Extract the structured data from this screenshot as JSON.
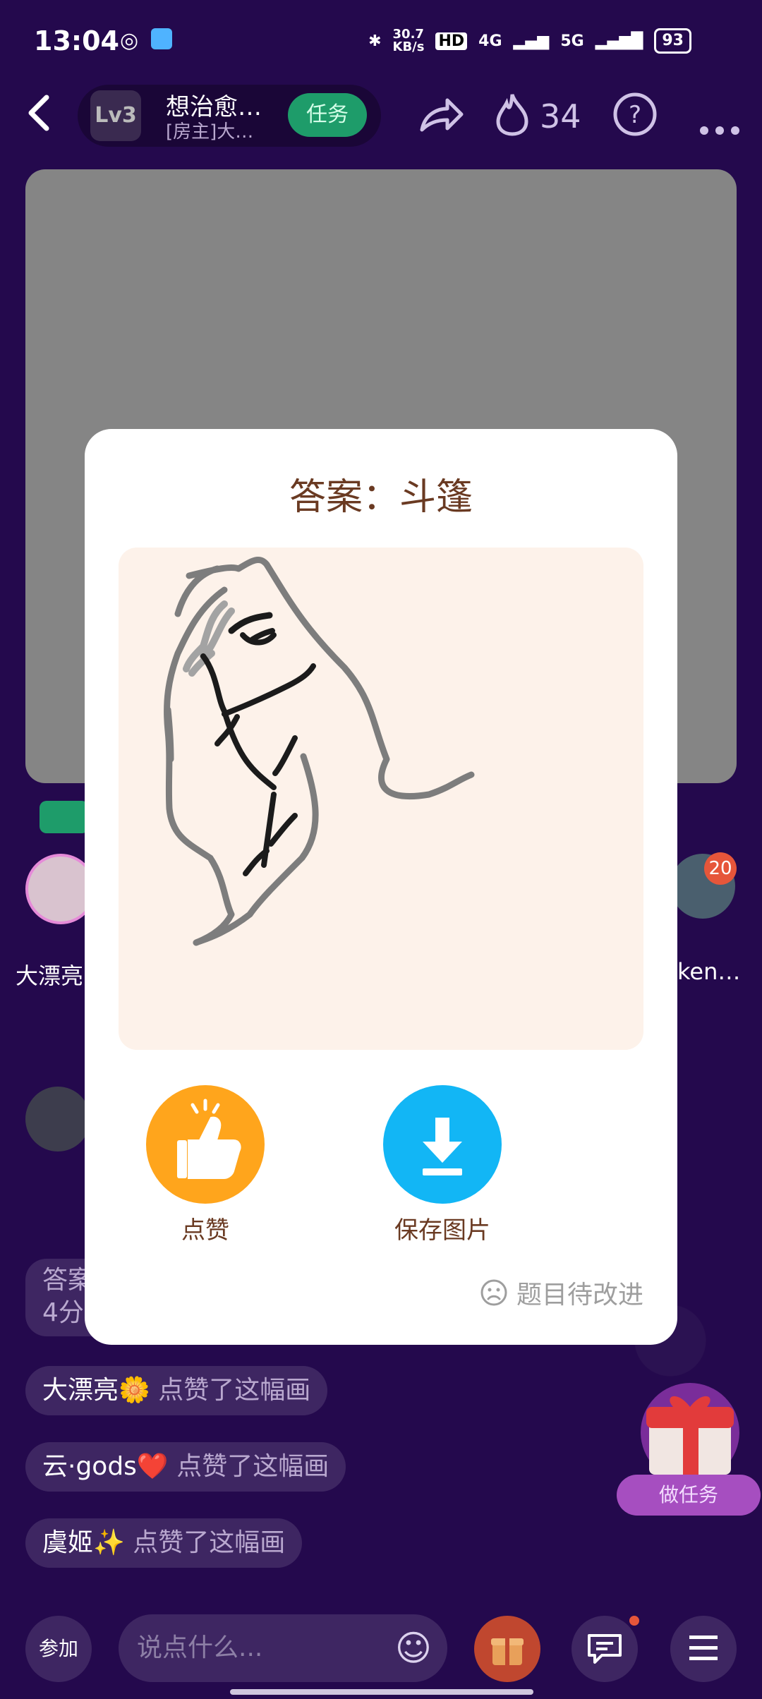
{
  "status": {
    "time": "13:04",
    "net_speed_value": "30.7",
    "net_speed_unit": "KB/s",
    "net1": "4G",
    "net2": "5G",
    "battery": "93"
  },
  "room": {
    "level": "Lv3",
    "name": "想治愈…",
    "owner": "[房主]大…",
    "task_label": "任务",
    "fire_count": "34"
  },
  "seats": {
    "left_name": "大漂亮",
    "right_name": "ken…",
    "right_badge": "20"
  },
  "modal": {
    "answer": "答案：斗篷",
    "like_label": "点赞",
    "save_label": "保存图片",
    "improve_label": "题目待改进"
  },
  "chat": [
    {
      "user": "大漂亮🌼",
      "action": "点赞了这幅画"
    },
    {
      "user": "云·gods❤️",
      "action": "点赞了这幅画"
    },
    {
      "user": "虞姬✨",
      "action": "点赞了这幅画"
    }
  ],
  "partial_msg": {
    "line1": "答案",
    "line2": "4分"
  },
  "bottom": {
    "join_label": "参加",
    "input_placeholder": "说点什么...",
    "gift_task_label": "做任务"
  },
  "colors": {
    "background": "#2d0c5e",
    "like": "#ffa51c",
    "save": "#12b6f5",
    "task": "#1e9c6a",
    "answer_text": "#6a3a22"
  },
  "icons": [
    "back-icon",
    "share-icon",
    "fire-icon",
    "help-icon",
    "more-icon",
    "thumbs-up-icon",
    "download-icon",
    "sad-face-icon",
    "emoji-icon",
    "gift-icon",
    "chat-icon",
    "menu-icon"
  ]
}
